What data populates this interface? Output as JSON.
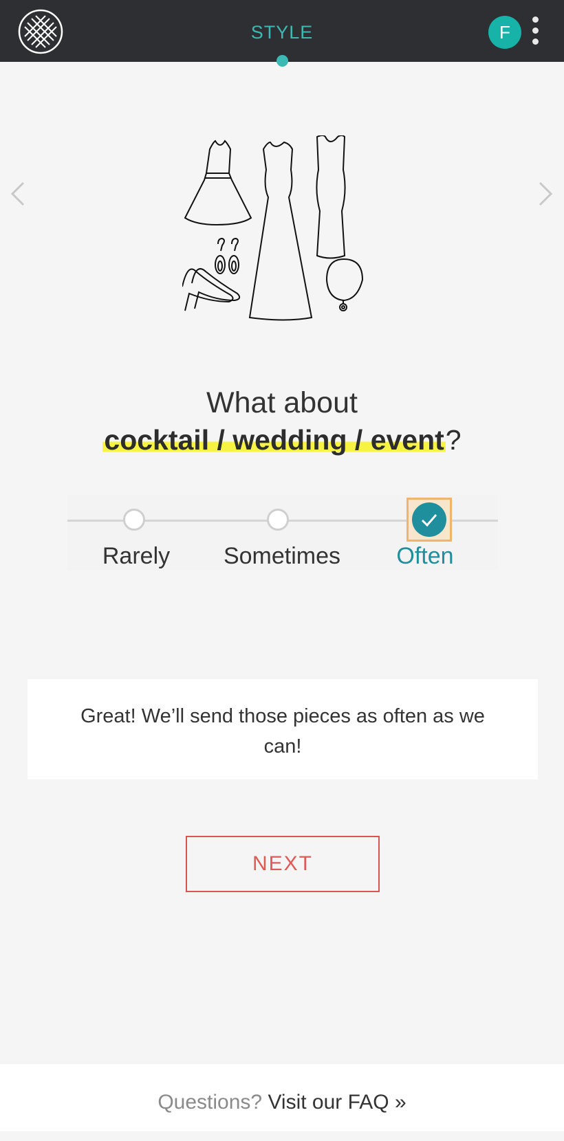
{
  "header": {
    "title": "STYLE",
    "avatar_initial": "F",
    "logo_icon": "stitch-fix-logo-icon",
    "menu_icon": "kebab-menu-icon"
  },
  "navigation": {
    "prev_icon": "chevron-left-icon",
    "next_icon": "chevron-right-icon"
  },
  "question": {
    "line1": "What about",
    "highlight": "cocktail / wedding / event",
    "suffix": "?"
  },
  "frequency": {
    "options": [
      "Rarely",
      "Sometimes",
      "Often"
    ],
    "selected": "Often"
  },
  "feedback": "Great! We’ll send those pieces as often as we can!",
  "next_button": "NEXT",
  "footer": {
    "question": "Questions?",
    "link": "Visit our FAQ »"
  },
  "colors": {
    "accent": "#3cb9b4",
    "selected": "#1f8e9d",
    "next": "#d9534f",
    "highlight": "#f7f345"
  }
}
